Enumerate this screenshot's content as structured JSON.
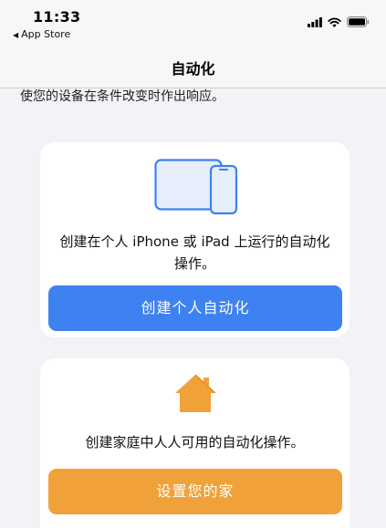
{
  "status_bar": {
    "time": "11:33",
    "back_app": "App Store"
  },
  "nav": {
    "title": "自动化"
  },
  "intro_text": "使您的设备在条件改变时作出响应。",
  "personal_card": {
    "description": "创建在个人 iPhone 或 iPad 上运行的自动化操作。",
    "button_label": "创建个人自动化",
    "button_color": "#3d82f0"
  },
  "home_card": {
    "description": "创建家庭中人人可用的自动化操作。",
    "button_label": "设置您的家",
    "button_color": "#f0a13a"
  },
  "icons": {
    "signal": "cellular-signal-icon",
    "wifi": "wifi-icon",
    "battery": "battery-icon",
    "devices": "ipad-iphone-icon",
    "home": "house-icon"
  }
}
